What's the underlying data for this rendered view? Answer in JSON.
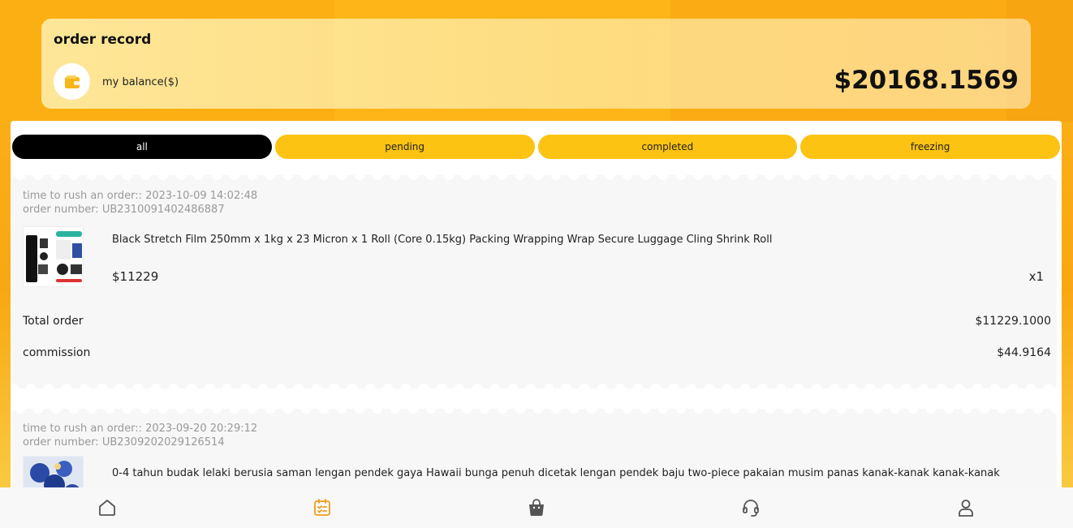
{
  "header": {
    "title": "order record",
    "balance_label": "my balance($)",
    "balance_value": "$20168.1569"
  },
  "tabs": [
    {
      "label": "all",
      "active": true
    },
    {
      "label": "pending",
      "active": false
    },
    {
      "label": "completed",
      "active": false
    },
    {
      "label": "freezing",
      "active": false
    }
  ],
  "orders": [
    {
      "time_label": "time to rush an order:: 2023-10-09 14:02:48",
      "order_number_label": "order number: UB2310091402486887",
      "product_name": "Black Stretch Film 250mm x 1kg x 23 Micron x 1 Roll (Core 0.15kg) Packing Wrapping Wrap Secure Luggage Cling Shrink Roll",
      "price": "$11229",
      "quantity": "x1",
      "total_label": "Total order",
      "total_value": "$11229.1000",
      "commission_label": "commission",
      "commission_value": "$44.9164"
    },
    {
      "time_label": "time to rush an order:: 2023-09-20 20:29:12",
      "order_number_label": "order number: UB2309202029126514",
      "product_name": "0-4 tahun budak lelaki berusia saman lengan pendek gaya Hawaii bunga penuh dicetak lengan pendek baju two-piece pakaian musim panas kanak-kanak kanak-kanak"
    }
  ],
  "nav": [
    {
      "icon": "home-icon",
      "active": false
    },
    {
      "icon": "order-checklist-icon",
      "active": true
    },
    {
      "icon": "shopping-bag-icon",
      "active": false
    },
    {
      "icon": "headset-support-icon",
      "active": false
    },
    {
      "icon": "user-profile-icon",
      "active": false
    }
  ],
  "colors": {
    "accent": "#fcc313",
    "active_tab": "#000000",
    "nav_active": "#f39a1a",
    "nav_inactive": "#555555"
  }
}
